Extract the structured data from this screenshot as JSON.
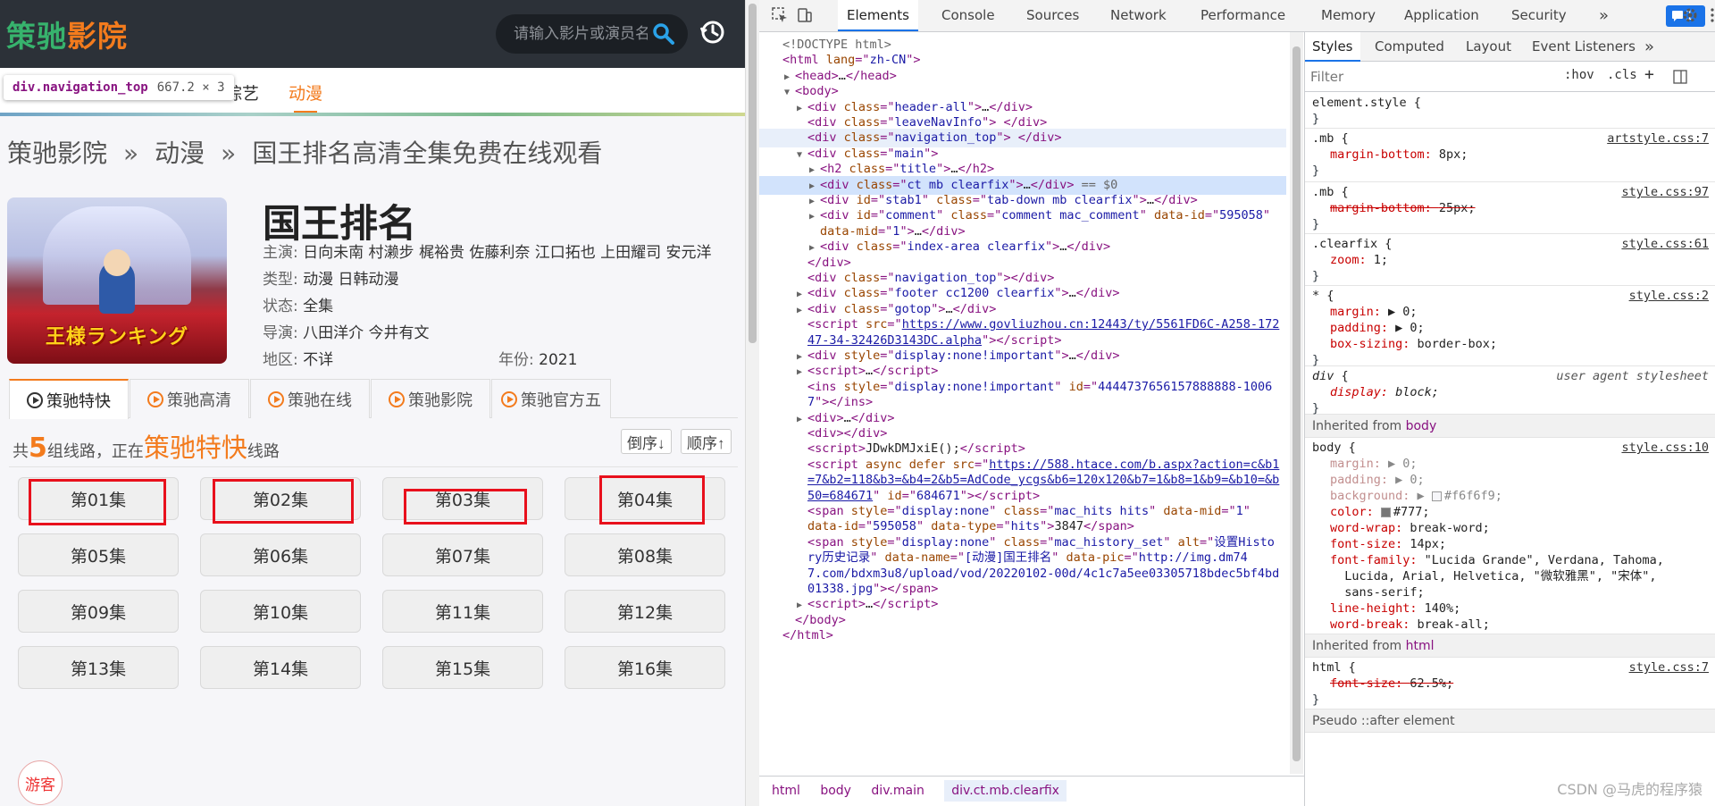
{
  "site": {
    "logo_part1": "策驰",
    "logo_part2": "影院",
    "search_placeholder": "请输入影片或演员名",
    "nav": [
      {
        "label": "综艺"
      },
      {
        "label": "动漫"
      }
    ],
    "tooltip_tag": "div.navigation_top",
    "tooltip_size": "667.2 × 3",
    "breadcrumb": [
      "策驰影院",
      "»",
      "动漫",
      "»",
      "国王排名高清全集免费在线观看"
    ],
    "poster_title": "王様ランキング",
    "title": "国王排名",
    "info": {
      "actors_label": "主演:",
      "actors": "日向未南 村濑步 梶裕贵 佐藤利奈 江口拓也 上田耀司 安元洋",
      "type_label": "类型:",
      "type": "动漫 日韩动漫",
      "status_label": "状态:",
      "status": "全集",
      "director_label": "导演:",
      "director": "八田洋介 今井有文",
      "region_label": "地区:",
      "region": "不详",
      "year_label": "年份:",
      "year": "2021"
    },
    "tabs": [
      "策驰特快",
      "策驰高清",
      "策驰在线",
      "策驰影院",
      "策驰官方五"
    ],
    "routes": {
      "prefix": "共",
      "count": "5",
      "middle": "组线路，正在",
      "source": "策驰特快",
      "suffix": "线路"
    },
    "sort_desc": "倒序↓",
    "sort_asc": "顺序↑",
    "episodes": [
      "第01集",
      "第02集",
      "第03集",
      "第04集",
      "第05集",
      "第06集",
      "第07集",
      "第08集",
      "第09集",
      "第10集",
      "第11集",
      "第12集",
      "第13集",
      "第14集",
      "第15集",
      "第16集"
    ],
    "guest": "游客"
  },
  "devtools": {
    "tabs": [
      "Elements",
      "Console",
      "Sources",
      "Network",
      "Performance",
      "Memory",
      "Application",
      "Security"
    ],
    "more": "»",
    "badge": "1",
    "dom_lines": [
      {
        "indent": 0,
        "tri": "",
        "html": "<span class='cm'>&lt;!DOCTYPE html&gt;</span>"
      },
      {
        "indent": 0,
        "tri": "",
        "html": "<span class='tag'>&lt;html </span><span class='attr'>lang</span>=\"<span class='val'>zh-CN</span>\"<span class='tag'>&gt;</span>"
      },
      {
        "indent": 1,
        "tri": "▶",
        "html": "<span class='tag'>&lt;head&gt;</span><span class='txt'>…</span><span class='tag'>&lt;/head&gt;</span>"
      },
      {
        "indent": 1,
        "tri": "▼",
        "html": "<span class='tag'>&lt;body&gt;</span>"
      },
      {
        "indent": 2,
        "tri": "▶",
        "html": "<span class='tag'>&lt;div </span><span class='attr'>class</span>=\"<span class='val'>header-all</span>\"<span class='tag'>&gt;</span><span class='txt'>…</span><span class='tag'>&lt;/div&gt;</span>"
      },
      {
        "indent": 2,
        "tri": "",
        "html": "<span class='tag'>&lt;div </span><span class='attr'>class</span>=\"<span class='val'>leaveNavInfo</span>\"<span class='tag'>&gt; &lt;/div&gt;</span>"
      },
      {
        "indent": 2,
        "tri": "",
        "hl": true,
        "html": "<span class='tag'>&lt;div </span><span class='attr'>class</span>=\"<span class='val'>navigation_top</span>\"<span class='tag'>&gt; &lt;/div&gt;</span>"
      },
      {
        "indent": 2,
        "tri": "▼",
        "html": "<span class='tag'>&lt;div </span><span class='attr'>class</span>=\"<span class='val'>main</span>\"<span class='tag'>&gt;</span>"
      },
      {
        "indent": 3,
        "tri": "▶",
        "html": "<span class='tag'>&lt;h2 </span><span class='attr'>class</span>=\"<span class='val'>title</span>\"<span class='tag'>&gt;</span><span class='txt'>…</span><span class='tag'>&lt;/h2&gt;</span>"
      },
      {
        "indent": 3,
        "tri": "▶",
        "sel": true,
        "html": "<span class='tag'>&lt;div </span><span class='attr'>class</span>=\"<span class='val'>ct mb clearfix</span>\"<span class='tag'>&gt;</span><span class='txt'>…</span><span class='tag'>&lt;/div&gt;</span><span class='cm'> == $0</span>"
      },
      {
        "indent": 3,
        "tri": "▶",
        "html": "<span class='tag'>&lt;div </span><span class='attr'>id</span>=\"<span class='val'>stab1</span>\" <span class='attr'>class</span>=\"<span class='val'>tab-down mb clearfix</span>\"<span class='tag'>&gt;</span><span class='txt'>…</span><span class='tag'>&lt;/div&gt;</span>"
      },
      {
        "indent": 3,
        "tri": "▶",
        "html": "<span class='tag'>&lt;div </span><span class='attr'>id</span>=\"<span class='val'>comment</span>\" <span class='attr'>class</span>=\"<span class='val'>comment mac_comment</span>\" <span class='attr'>data-id</span>=\"<span class='val'>595058</span>\""
      },
      {
        "indent": 3,
        "tri": "",
        "html": "<span class='attr'>data-mid</span>=\"<span class='val'>1</span>\"<span class='tag'>&gt;</span><span class='txt'>…</span><span class='tag'>&lt;/div&gt;</span>"
      },
      {
        "indent": 3,
        "tri": "▶",
        "html": "<span class='tag'>&lt;div </span><span class='attr'>class</span>=\"<span class='val'>index-area clearfix</span>\"<span class='tag'>&gt;</span><span class='txt'>…</span><span class='tag'>&lt;/div&gt;</span>"
      },
      {
        "indent": 2,
        "tri": "",
        "html": "<span class='tag'>&lt;/div&gt;</span>"
      },
      {
        "indent": 2,
        "tri": "",
        "html": "<span class='tag'>&lt;div </span><span class='attr'>class</span>=\"<span class='val'>navigation_top</span>\"<span class='tag'>&gt;&lt;/div&gt;</span>"
      },
      {
        "indent": 2,
        "tri": "▶",
        "html": "<span class='tag'>&lt;div </span><span class='attr'>class</span>=\"<span class='val'>footer cc1200 clearfix</span>\"<span class='tag'>&gt;</span><span class='txt'>…</span><span class='tag'>&lt;/div&gt;</span>"
      },
      {
        "indent": 2,
        "tri": "▶",
        "html": "<span class='tag'>&lt;div </span><span class='attr'>class</span>=\"<span class='val'>gotop</span>\"<span class='tag'>&gt;</span><span class='txt'>…</span><span class='tag'>&lt;/div&gt;</span>"
      },
      {
        "indent": 2,
        "tri": "",
        "html": "<span class='tag'>&lt;script </span><span class='attr'>src</span>=\"<span class='link'>https://www.govliuzhou.cn:12443/ty/5561FD6C-A258-172</span>"
      },
      {
        "indent": 2,
        "tri": "",
        "html": "<span class='link'>47-34-32426D3143DC.alpha</span>\"<span class='tag'>&gt;&lt;/script&gt;</span>"
      },
      {
        "indent": 2,
        "tri": "▶",
        "html": "<span class='tag'>&lt;div </span><span class='attr'>style</span>=\"<span class='val'>display:none!important</span>\"<span class='tag'>&gt;</span><span class='txt'>…</span><span class='tag'>&lt;/div&gt;</span>"
      },
      {
        "indent": 2,
        "tri": "▶",
        "html": "<span class='tag'>&lt;script&gt;</span><span class='txt'>…</span><span class='tag'>&lt;/script&gt;</span>"
      },
      {
        "indent": 2,
        "tri": "",
        "html": "<span class='tag'>&lt;ins </span><span class='attr'>style</span>=\"<span class='val'>display:none!important</span>\" <span class='attr'>id</span>=\"<span class='val'>4444737656157888888-1006</span>"
      },
      {
        "indent": 2,
        "tri": "",
        "html": "<span class='val'>7</span>\"<span class='tag'>&gt;&lt;/ins&gt;</span>"
      },
      {
        "indent": 2,
        "tri": "▶",
        "html": "<span class='tag'>&lt;div&gt;</span><span class='txt'>…</span><span class='tag'>&lt;/div&gt;</span>"
      },
      {
        "indent": 2,
        "tri": "",
        "html": "<span class='tag'>&lt;div&gt;&lt;/div&gt;</span>"
      },
      {
        "indent": 2,
        "tri": "",
        "html": "<span class='tag'>&lt;script&gt;</span><span class='txt'>JDwkDMJxiE();</span><span class='tag'>&lt;/script&gt;</span>"
      },
      {
        "indent": 2,
        "tri": "",
        "html": "<span class='tag'>&lt;script </span><span class='attr'>async defer src</span>=\"<span class='link'>https://588.htace.com/b.aspx?action=c&amp;b1</span>"
      },
      {
        "indent": 2,
        "tri": "",
        "html": "<span class='link'>=7&amp;b2=118&amp;b3=&amp;b4=2&amp;b5=AdCode_ycgs&amp;b6=120x120&amp;b7=1&amp;b8=1&amp;b9=&amp;b10=&amp;b</span>"
      },
      {
        "indent": 2,
        "tri": "",
        "html": "<span class='link'>50=684671</span>\" <span class='attr'>id</span>=\"<span class='val'>684671</span>\"<span class='tag'>&gt;&lt;/script&gt;</span>"
      },
      {
        "indent": 2,
        "tri": "",
        "html": "<span class='tag'>&lt;span </span><span class='attr'>style</span>=\"<span class='val'>display:none</span>\" <span class='attr'>class</span>=\"<span class='val'>mac_hits hits</span>\" <span class='attr'>data-mid</span>=\"<span class='val'>1</span>\""
      },
      {
        "indent": 2,
        "tri": "",
        "html": "<span class='attr'>data-id</span>=\"<span class='val'>595058</span>\" <span class='attr'>data-type</span>=\"<span class='val'>hits</span>\"<span class='tag'>&gt;</span><span class='txt'>3847</span><span class='tag'>&lt;/span&gt;</span>"
      },
      {
        "indent": 2,
        "tri": "",
        "html": "<span class='tag'>&lt;span </span><span class='attr'>style</span>=\"<span class='val'>display:none</span>\" <span class='attr'>class</span>=\"<span class='val'>mac_history_set</span>\" <span class='attr'>alt</span>=\"<span class='val'>设置Histo</span>"
      },
      {
        "indent": 2,
        "tri": "",
        "html": "<span class='val'>ry历史记录</span>\" <span class='attr'>data-name</span>=\"<span class='val'>[动漫]国王排名</span>\" <span class='attr'>data-pic</span>=\"<span class='val'>http://img.dm74</span>"
      },
      {
        "indent": 2,
        "tri": "",
        "html": "<span class='val'>7.com/bdxm3u8/upload/vod/20220102-00d/4c1c7a5ee03305718bdec5bf4bd</span>"
      },
      {
        "indent": 2,
        "tri": "",
        "html": "<span class='val'>01338.jpg</span>\"<span class='tag'>&gt;&lt;/span&gt;</span>"
      },
      {
        "indent": 2,
        "tri": "▶",
        "html": "<span class='tag'>&lt;script&gt;</span><span class='txt'>…</span><span class='tag'>&lt;/script&gt;</span>"
      },
      {
        "indent": 1,
        "tri": "",
        "html": "<span class='tag'>&lt;/body&gt;</span>"
      },
      {
        "indent": 0,
        "tri": "",
        "html": "<span class='tag'>&lt;/html&gt;</span>"
      }
    ],
    "crumbs": [
      "html",
      "body",
      "div.main",
      "div.ct.mb.clearfix"
    ],
    "styles_tabs": [
      "Styles",
      "Computed",
      "Layout",
      "Event Listeners",
      "»"
    ],
    "filter_placeholder": "Filter",
    "hov": ":hov",
    "cls": ".cls",
    "plus": "+",
    "inherited_label": "Inherited from",
    "inherited_body": "body",
    "inherited_html": "html",
    "pseudo": "Pseudo ::after element",
    "watermark": "CSDN @马虎的程序猿",
    "colors": {
      "accent": "#1a73e8",
      "brand_green": "#37b36d",
      "brand_orange": "#f37b1d",
      "red_box": "#e8101c"
    }
  }
}
